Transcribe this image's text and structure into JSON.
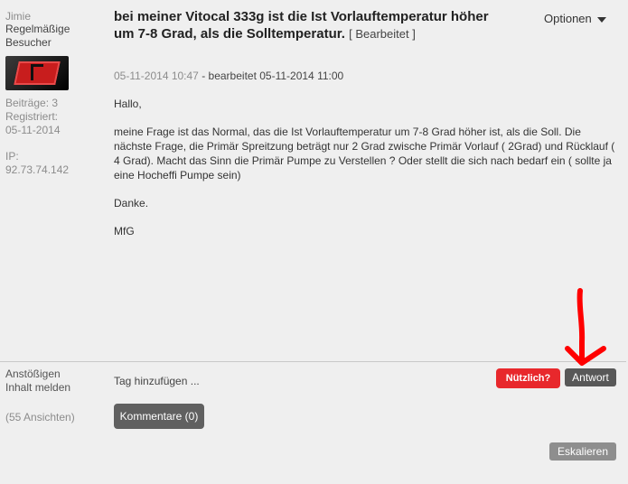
{
  "author": {
    "username": "Jimie",
    "rank": "Regelmäßige Besucher",
    "posts": "Beiträge: 3",
    "registered_label": "Registriert:",
    "registered_date": "05-11-2014",
    "ip_label": "IP:",
    "ip": "92.73.74.142"
  },
  "post": {
    "title": "bei meiner Vitocal 333g ist die Ist Vorlauftemperatur höher um 7-8 Grad, als die Solltemperatur.",
    "edited_tag": "[ Bearbeitet ]",
    "date": "05-11-2014 10:47",
    "edit_info": "- bearbeitet 05-11-2014 11:00",
    "body": [
      "Hallo,",
      "meine Frage ist das Normal, das die Ist Vorlauftemperatur um 7-8 Grad höher ist, als die Soll. Die nächste Frage, die Primär Spreitzung beträgt nur 2 Grad zwische Primär Vorlauf  ( 2Grad) und Rücklauf ( 4 Grad). Macht das Sinn die Primär Pumpe zu Verstellen ? Oder stellt die sich nach bedarf ein ( sollte ja eine Hocheffi Pumpe sein)",
      "Danke.",
      "MfG"
    ]
  },
  "options": {
    "label": "Optionen"
  },
  "footer": {
    "report_label": "Anstößigen Inhalt melden",
    "views": "(55 Ansichten)",
    "tag_add": "Tag hinzufügen ...",
    "comments_button": "Kommentare (0)",
    "useful_button": "Nützlich?",
    "reply_button": "Antwort",
    "escalate_button": "Eskalieren"
  },
  "colors": {
    "background": "#efefef",
    "useful_red": "#e8282c",
    "button_dark": "#585858",
    "annotation_arrow": "#ff0000"
  }
}
